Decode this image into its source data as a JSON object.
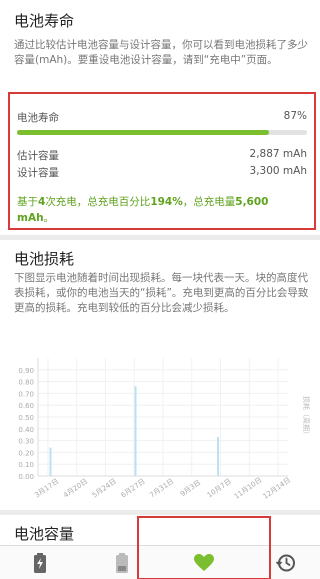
{
  "life": {
    "title": "电池寿命",
    "description": "通过比较估计电池容量与设计容量，你可以看到电池损耗了多少容量(mAh)。要重设电池设计容量，请到“充电中”页面。",
    "label": "电池寿命",
    "percent_text": "87%",
    "percent_value": 0.87,
    "estimated_label": "估计容量",
    "estimated_value": "2,887 mAh",
    "design_label": "设计容量",
    "design_value": "3,300 mAh",
    "summary_prefix": "基于",
    "summary_count": "4",
    "summary_mid1": "次充电，总充电百分比",
    "summary_percent": "194%",
    "summary_mid2": "，总充电量",
    "summary_amount": "5,600 mAh",
    "summary_suffix": "。",
    "accent_color": "#7cbf2e"
  },
  "wear": {
    "title": "电池损耗",
    "description": "下图显示电池随着时间出现损耗。每一块代表一天。块的高度代表损耗，或你的电池当天的“损耗”。充电到更高的百分比会导致更高的损耗。充电到较低的百分比会减少损耗。"
  },
  "capacity": {
    "title": "电池容量"
  },
  "chart_data": {
    "type": "bar",
    "title": "",
    "xlabel": "",
    "ylabel": "损耗（周期）",
    "ylim": [
      0,
      1.0
    ],
    "y_ticks": [
      "0.90",
      "0.80",
      "0.70",
      "0.60",
      "0.50",
      "0.40",
      "0.30",
      "0.20",
      "0.10",
      "0.00"
    ],
    "x_ticks": [
      "3月17日",
      "4月20日",
      "5月24日",
      "6月27日",
      "7月31日",
      "9月3日",
      "10月7日",
      "11月10日",
      "12月14日"
    ],
    "bar_color": "#bfe0ef",
    "bars": [
      {
        "x": 0.05,
        "value": 0.24
      },
      {
        "x": 0.39,
        "value": 0.76
      },
      {
        "x": 0.72,
        "value": 0.33
      }
    ]
  },
  "nav": {
    "items": [
      {
        "name": "nav-charging",
        "icon": "battery-charging-icon"
      },
      {
        "name": "nav-discharging",
        "icon": "battery-icon"
      },
      {
        "name": "nav-health",
        "icon": "heart-icon",
        "selected": true
      },
      {
        "name": "nav-history",
        "icon": "history-icon"
      }
    ],
    "selected_color": "#7cbf2e"
  }
}
